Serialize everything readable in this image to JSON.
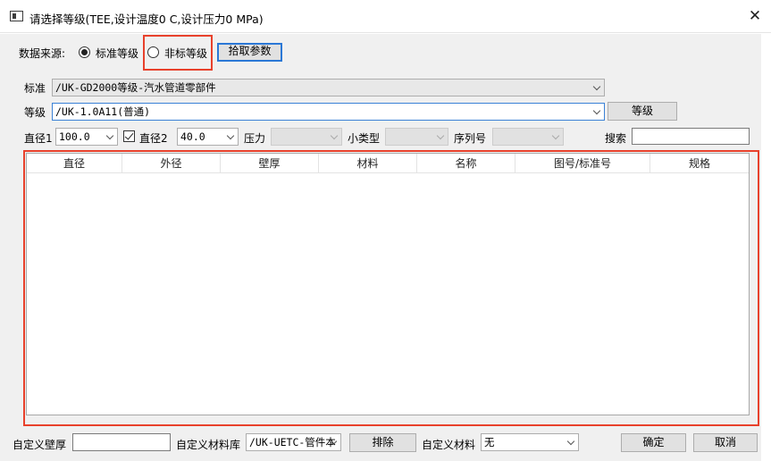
{
  "window": {
    "title": "请选择等级(TEE,设计温度0 C,设计压力0 MPa)",
    "close_glyph": "✕"
  },
  "source": {
    "label": "数据来源:",
    "standard_grade": "标准等级",
    "nonstandard_grade": "非标等级",
    "selected": "standard",
    "pick_button": "拾取参数"
  },
  "standard": {
    "label": "标准",
    "value": "/UK-GD2000等级-汽水管道零部件"
  },
  "grade": {
    "label": "等级",
    "value": "/UK-1.0A11(普通)",
    "button": "等级"
  },
  "filters": {
    "diameter1_label": "直径1",
    "diameter1_value": "100.0",
    "diameter2_label": "直径2",
    "diameter2_checked": true,
    "diameter2_value": "40.0",
    "pressure_label": "压力",
    "subtype_label": "小类型",
    "serial_label": "序列号",
    "search_label": "搜索",
    "search_value": ""
  },
  "table": {
    "columns": [
      "直径",
      "外径",
      "壁厚",
      "材料",
      "名称",
      "图号/标准号",
      "规格"
    ],
    "rows": []
  },
  "footer": {
    "custom_thickness_label": "自定义壁厚",
    "custom_thickness_value": "",
    "custom_material_lib_label": "自定义材料库",
    "custom_material_lib_value": "/UK-UETC-管件本",
    "exclude_button": "排除",
    "custom_material_label": "自定义材料",
    "custom_material_value": "无",
    "ok_button": "确定",
    "cancel_button": "取消"
  },
  "colors": {
    "highlight_border": "#e8412c",
    "focus_border": "#2b78d6"
  }
}
